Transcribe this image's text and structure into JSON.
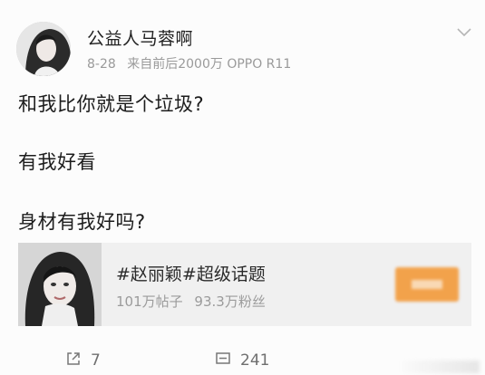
{
  "post": {
    "author": "公益人马蓉啊",
    "date": "8-28",
    "source": "来自前后2000万 OPPO R11",
    "lines": [
      "和我比你就是个垃圾?",
      "有我好看",
      "身材有我好吗?"
    ]
  },
  "topic_card": {
    "title": "#赵丽颖#超级话题",
    "posts": "101万帖子",
    "fans": "93.3万粉丝",
    "button_color": "#f39a3a"
  },
  "actions": {
    "repost_count": "7",
    "comment_count": "241"
  },
  "icons": {
    "expand": "chevron-down-icon",
    "repost": "repost-icon",
    "comment": "comment-icon"
  }
}
